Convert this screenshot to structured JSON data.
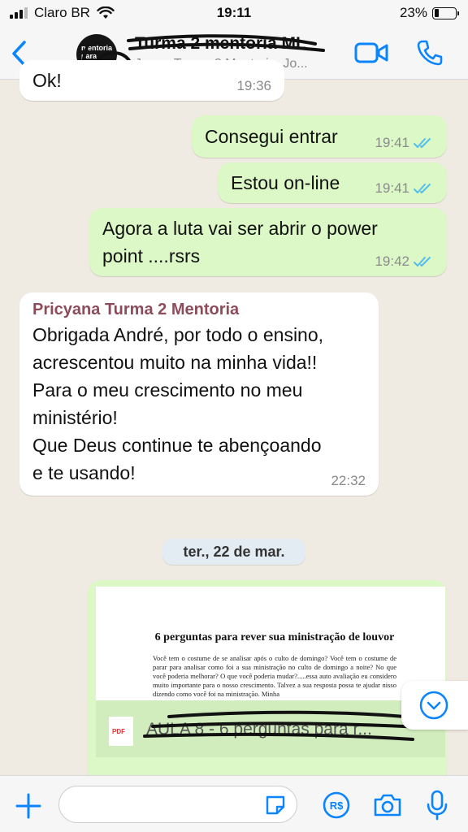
{
  "status_bar": {
    "carrier": "Claro BR",
    "time": "19:11",
    "battery_percent": "23%",
    "battery_level": 0.23
  },
  "header": {
    "title": "Turma 2 mentoria ML",
    "subtitle": "Jeane Turma 2 Mentoria, Jo...",
    "avatar_text": "mentoria para ministros"
  },
  "messages": [
    {
      "side": "in",
      "text": "Ok!",
      "time": "19:36"
    },
    {
      "side": "out",
      "text": "Consegui entrar",
      "time": "19:41",
      "status": "read"
    },
    {
      "side": "out",
      "text": "Estou on-line",
      "time": "19:41",
      "status": "read"
    },
    {
      "side": "out",
      "text_lines": [
        "Agora a luta vai ser abrir o power",
        "point ....rsrs"
      ],
      "time": "19:42",
      "status": "read"
    },
    {
      "side": "in",
      "sender": "Pricyana Turma 2 Mentoria",
      "text_lines": [
        "Obrigada André, por todo o ensino,",
        "acrescentou muito na minha vida!!",
        "Para o meu crescimento no meu",
        "ministério!",
        "Que Deus continue te abençoando",
        "e te usando!"
      ],
      "time": "22:32"
    }
  ],
  "date_divider": "ter., 22 de mar.",
  "document": {
    "heading": "6 perguntas para rever sua ministração de louvor",
    "body": "Você tem o costume de se analisar após o culto de domingo? Você tem o costume de parar para analisar como foi a sua ministração no culto de domingo a noite? No que você poderia melhorar? O que você poderia mudar?.....essa auto avaliação eu considero muito importante para o nosso crescimento. Talvez a sua resposta possa te ajudar nisso dizendo como você foi na ministração. Minha",
    "file_badge": "PDF",
    "file_name": "AULA 8 - 6 perguntas para r..."
  },
  "colors": {
    "incoming_bubble": "#ffffff",
    "outgoing_bubble": "#dcf8c6",
    "accent_blue": "#0a84ff",
    "read_ticks": "#53bdeb",
    "sender_name": "#8d4b5b",
    "chat_background": "#efeae2"
  },
  "icons": {
    "back": "chevron-left-icon",
    "video_call": "video-camera-icon",
    "voice_call": "phone-icon",
    "attach": "plus-icon",
    "sticker": "sticker-icon",
    "payment": "pix-payment-icon",
    "camera": "camera-icon",
    "mic": "microphone-icon",
    "scroll_down": "chevron-down-circle-icon"
  }
}
